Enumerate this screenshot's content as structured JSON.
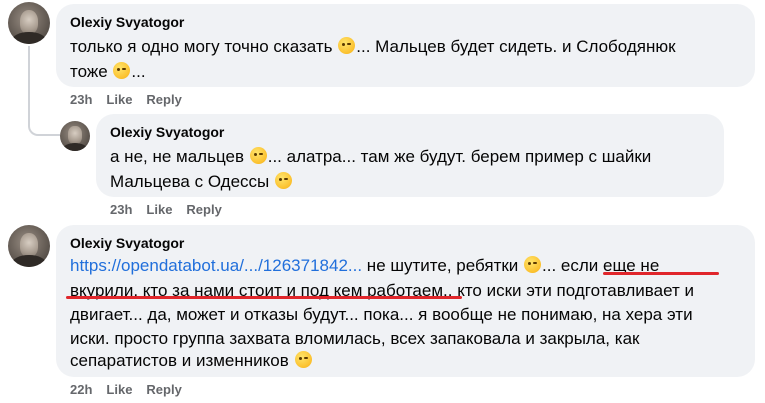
{
  "comments": [
    {
      "author": "Olexiy Svyatogor",
      "lines": [
        [
          "только я одно могу точно сказать ",
          "... Мальцев будет сидеть. и Слободянюк"
        ],
        [
          "тоже ",
          "..."
        ]
      ],
      "time": "23h",
      "like": "Like",
      "reply": "Reply"
    },
    {
      "author": "Olexiy Svyatogor",
      "lines": [
        [
          "а не, не мальцев ",
          "... алатра... там же будут. берем пример с шайки"
        ],
        [
          "Мальцева с Одессы ",
          ""
        ]
      ],
      "time": "23h",
      "like": "Like",
      "reply": "Reply"
    },
    {
      "author": "Olexiy Svyatogor",
      "link": "https://opendatabot.ua/.../126371842...",
      "line1_rest_a": " не шутите, ребятки ",
      "line1_rest_b": "... если еще не",
      "line2": "вкурили, кто за нами стоит и под кем работаем.. кто иски эти подготавливает и",
      "line3": "двигает... да, может и отказы будут... пока... я вообще не понимаю, на хера эти",
      "line4": "иски. просто группа захвата вломилась, всех запаковала и закрыла, как",
      "line5": "сепаратистов и изменников ",
      "time": "22h",
      "like": "Like",
      "reply": "Reply"
    }
  ],
  "colors": {
    "bubble": "#f0f2f5",
    "link": "#216fdb",
    "underline": "#e0262b",
    "meta": "#65676b"
  }
}
